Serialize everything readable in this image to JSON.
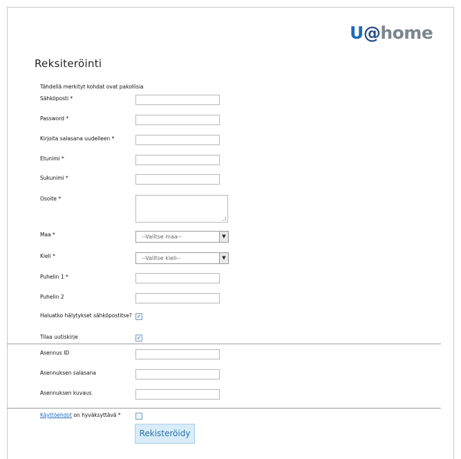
{
  "logo": {
    "u": "U",
    "at": "@",
    "home": "home"
  },
  "page_title": "Reksiteröinti",
  "required_note": "Tähdellä merkityt kohdat ovat pakollisia",
  "fields": {
    "email": {
      "label": "Sähköposti *",
      "value": ""
    },
    "password": {
      "label": "Password *",
      "value": ""
    },
    "password_again": {
      "label": "Kirjoita salasana uudelleen *",
      "value": ""
    },
    "first_name": {
      "label": "Etunimi *",
      "value": ""
    },
    "last_name": {
      "label": "Sukunimi *",
      "value": ""
    },
    "address": {
      "label": "Osoite *",
      "value": ""
    },
    "country": {
      "label": "Maa *",
      "selected": "--Valitse maa--"
    },
    "language": {
      "label": "Kieli *",
      "selected": "--Valitse kieli--"
    },
    "phone1": {
      "label": "Puhelin 1 *",
      "value": ""
    },
    "phone2": {
      "label": "Puhelin 2",
      "value": ""
    },
    "email_alerts": {
      "label": "Haluatko hälytykset sähköpostitse?",
      "checked": true
    },
    "newsletter": {
      "label": "Tilaa uutiskirje",
      "checked": true
    },
    "install_id": {
      "label": "Asennus ID",
      "value": ""
    },
    "install_password": {
      "label": "Asennuksen salasana",
      "value": ""
    },
    "install_description": {
      "label": "Asennuksen kuvaus",
      "value": ""
    }
  },
  "terms": {
    "link_text": "Käyttöehdot",
    "suffix": " on hyväksyttävä *",
    "checked": false
  },
  "submit_label": "Rekisteröidy",
  "colors": {
    "brand_blue": "#1f6bb7",
    "brand_grey": "#7d868e",
    "button_bg": "#d8ecf9"
  }
}
